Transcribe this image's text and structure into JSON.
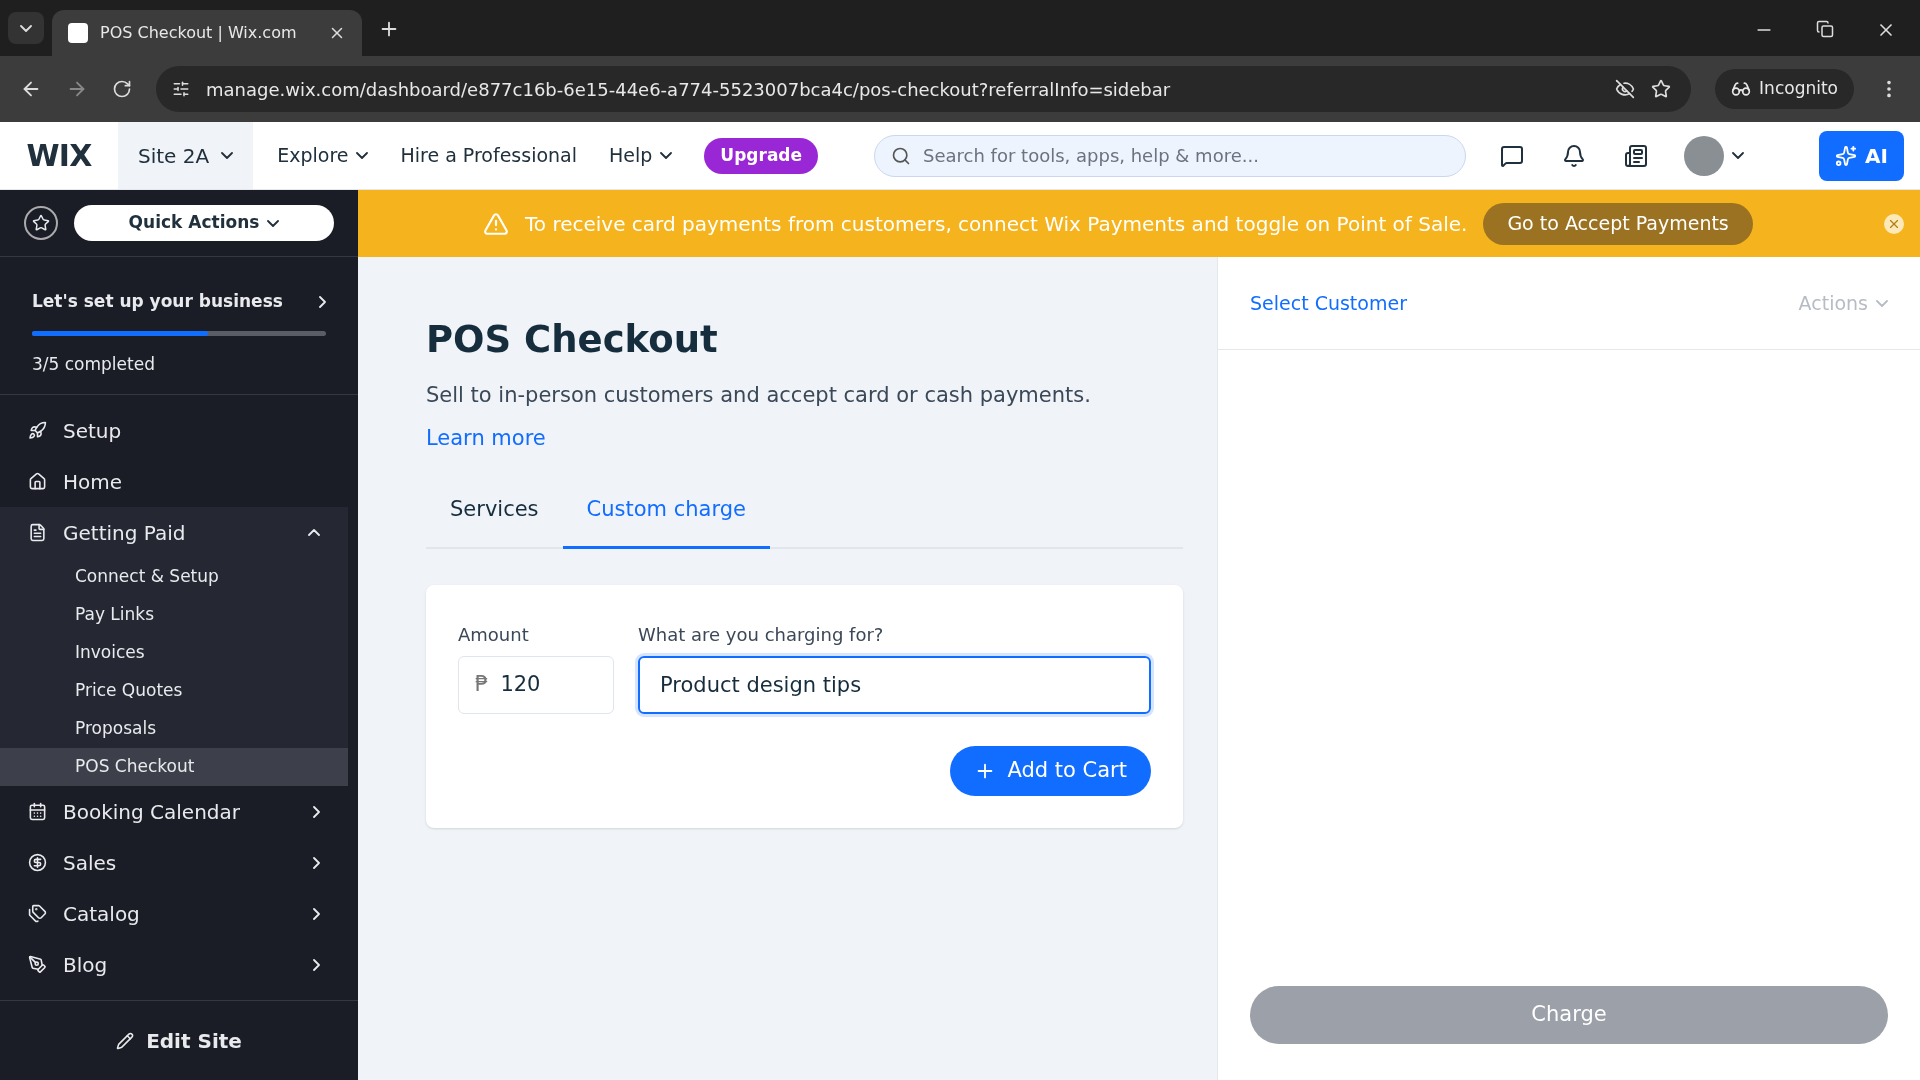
{
  "browser": {
    "tabs": [
      {
        "title": "POS Checkout | Wix.com",
        "selected": true
      }
    ],
    "url": "manage.wix.com/dashboard/e877c16b-6e15-44e6-a774-5523007bca4c/pos-checkout?referralInfo=sidebar",
    "incognito": "Incognito"
  },
  "header": {
    "logo": "WIX",
    "site": "Site 2A",
    "nav": [
      {
        "label": "Explore",
        "has_menu": true
      },
      {
        "label": "Hire a Professional",
        "has_menu": false
      },
      {
        "label": "Help",
        "has_menu": true
      }
    ],
    "upgrade": "Upgrade",
    "search": {
      "placeholder": "Search for tools, apps, help & more..."
    },
    "ai": "AI"
  },
  "banner": {
    "message": "To receive card payments from customers, connect Wix Payments and toggle on Point of Sale.",
    "button": "Go to Accept Payments"
  },
  "sidebar": {
    "quick_actions": "Quick Actions",
    "setup": {
      "title": "Let's set up your business",
      "level": 0.6,
      "progress": "3/5 completed"
    },
    "items": [
      {
        "label": "Setup",
        "kind": "link"
      },
      {
        "label": "Home",
        "kind": "link"
      },
      {
        "label": "Getting Paid",
        "kind": "group",
        "expanded": true,
        "children": [
          {
            "label": "Connect & Setup",
            "selected": false
          },
          {
            "label": "Pay Links",
            "selected": false
          },
          {
            "label": "Invoices",
            "selected": false
          },
          {
            "label": "Price Quotes",
            "selected": false
          },
          {
            "label": "Proposals",
            "selected": false
          },
          {
            "label": "POS Checkout",
            "selected": true
          }
        ]
      },
      {
        "label": "Booking Calendar",
        "kind": "group",
        "expanded": false
      },
      {
        "label": "Sales",
        "kind": "group",
        "expanded": false
      },
      {
        "label": "Catalog",
        "kind": "group",
        "expanded": false
      },
      {
        "label": "Blog",
        "kind": "group",
        "expanded": false
      }
    ],
    "edit_site": "Edit Site"
  },
  "main": {
    "title": "POS Checkout",
    "description": "Sell to in-person customers and accept card or cash payments.",
    "learn_more": "Learn more",
    "tabs": [
      {
        "label": "Services",
        "selected": false
      },
      {
        "label": "Custom charge",
        "selected": true
      }
    ],
    "form": {
      "amount_label": "Amount",
      "currency": "₱",
      "amount": "120",
      "charge_label": "What are you charging for?",
      "charge_value": "Product design tips",
      "add_button": "Add to Cart"
    }
  },
  "cart": {
    "select_customer": "Select Customer",
    "actions": "Actions",
    "charge": {
      "label": "Charge",
      "disabled": true
    }
  }
}
